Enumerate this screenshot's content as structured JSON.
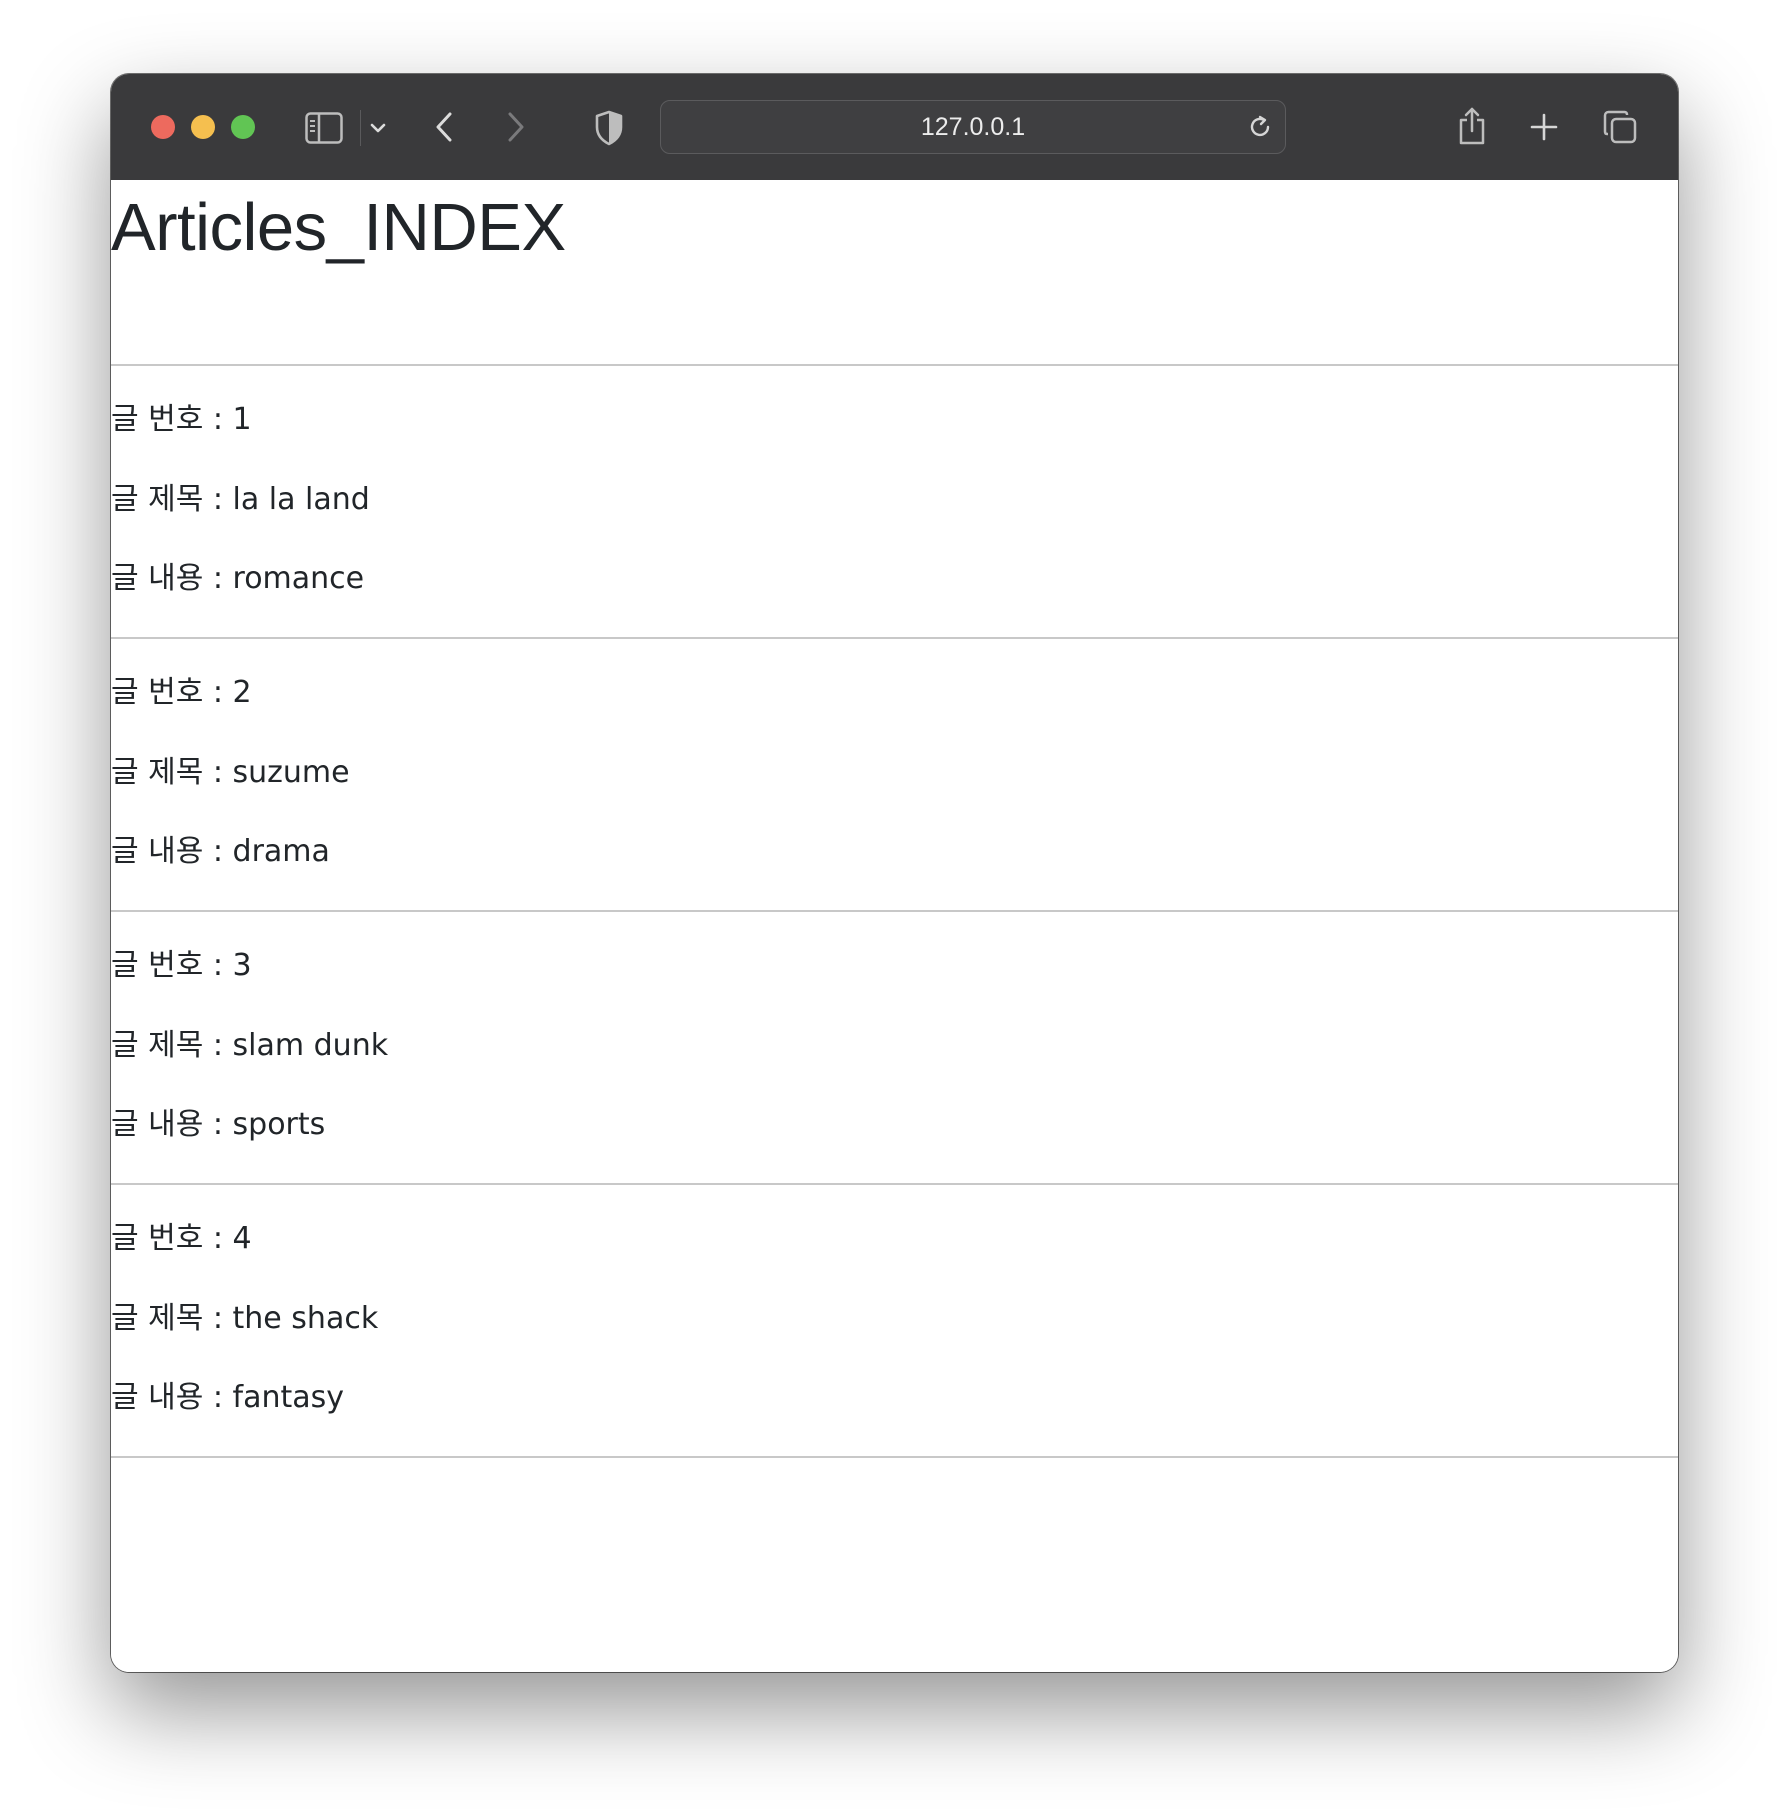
{
  "browser": {
    "url": "127.0.0.1"
  },
  "page": {
    "title": "Articles_INDEX",
    "field_labels": {
      "number": "글 번호 : ",
      "title": "글 제목 : ",
      "content": "글 내용 : "
    },
    "articles": [
      {
        "number": "1",
        "title": "la la land",
        "content": "romance"
      },
      {
        "number": "2",
        "title": "suzume",
        "content": "drama"
      },
      {
        "number": "3",
        "title": "slam dunk",
        "content": "sports"
      },
      {
        "number": "4",
        "title": "the shack",
        "content": "fantasy"
      }
    ]
  }
}
